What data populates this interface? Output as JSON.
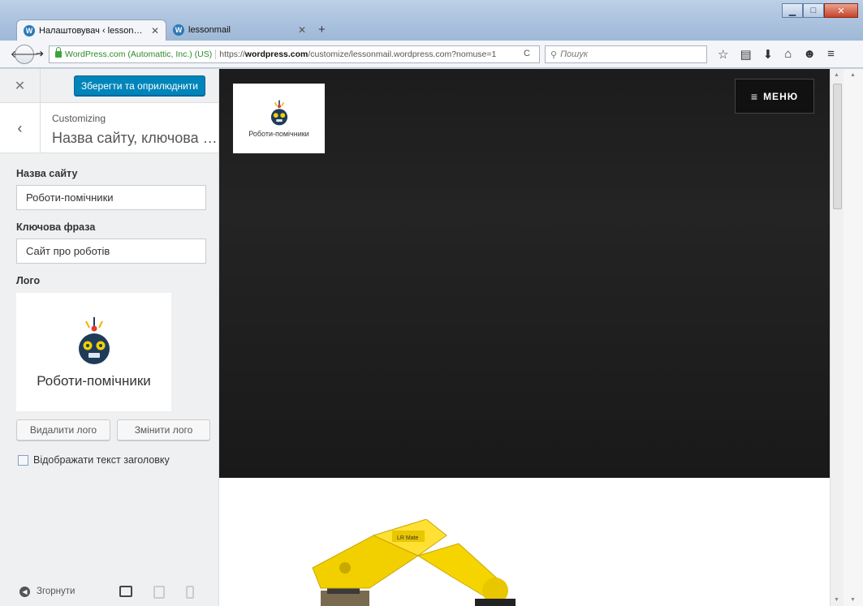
{
  "browser": {
    "tabs": [
      {
        "label": "Налаштовувач ‹ lessonma…",
        "active": true
      },
      {
        "label": "lessonmail",
        "active": false
      }
    ],
    "identity": "WordPress.com (Automattic, Inc.) (US)",
    "url_prefix": "https://",
    "url_domain": "wordpress.com",
    "url_path": "/customize/lessonmail.wordpress.com?nomuse=1",
    "search_placeholder": "Пошук",
    "new_tab": "+"
  },
  "customizer": {
    "save_label": "Зберегти та оприлюднити",
    "customizing": "Customizing",
    "section_title": "Назва сайту, ключова …",
    "site_title_label": "Назва сайту",
    "site_title_value": "Роботи-помічники",
    "tagline_label": "Ключова фраза",
    "tagline_value": "Сайт про роботів",
    "logo_label": "Лого",
    "logo_text": "Роботи-помічники",
    "remove_logo": "Видалити лого",
    "change_logo": "Змінити лого",
    "display_header_text": "Відображати текст заголовку",
    "collapse": "Згорнути"
  },
  "preview": {
    "logo_text": "Роботи-помічники",
    "menu_label": "МЕНЮ",
    "colors": {
      "hero": "#1c1c1c",
      "robot": "#f2d000",
      "robot_face": "#1f3b5a"
    }
  }
}
